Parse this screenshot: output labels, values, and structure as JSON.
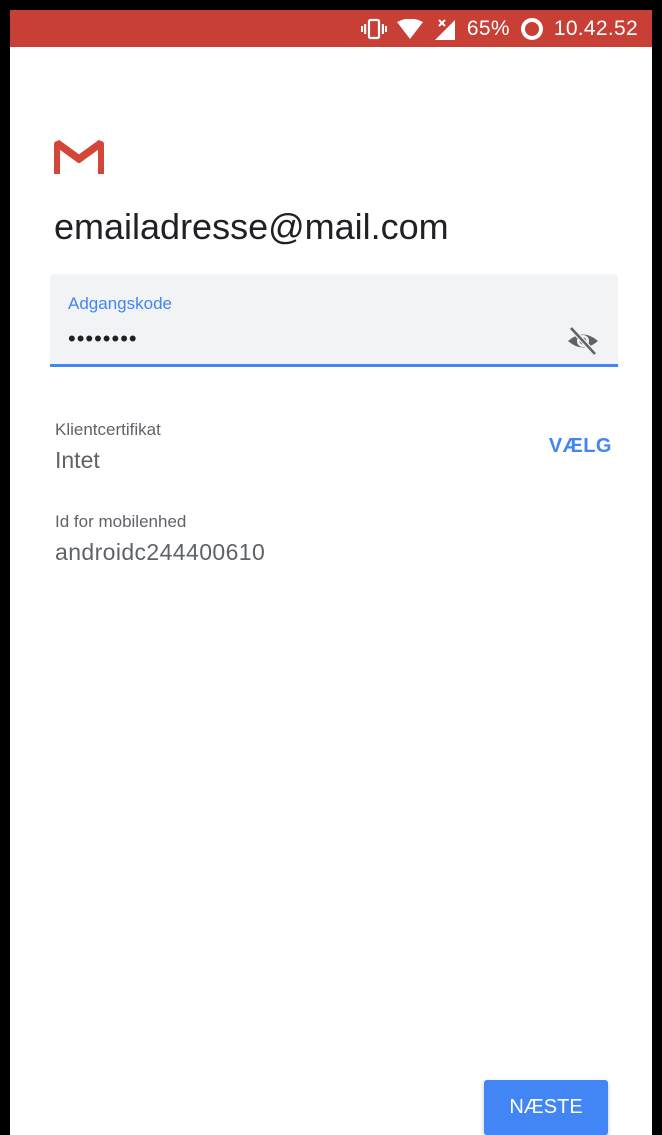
{
  "status_bar": {
    "battery": "65%",
    "time": "10.42.52",
    "icons": [
      "vibrate-icon",
      "wifi-icon",
      "cellular-no-signal-icon",
      "battery-icon"
    ],
    "background_color": "#c73f35"
  },
  "app": {
    "logo": "gmail-logo-icon",
    "brand_color": "#d44638"
  },
  "account": {
    "email": "emailadresse@mail.com"
  },
  "password": {
    "label": "Adgangskode",
    "value": "••••••••",
    "toggle_icon": "visibility-off-icon",
    "accent_color": "#4285f4"
  },
  "client_certificate": {
    "label": "Klientcertifikat",
    "value": "Intet",
    "action_label": "VÆLG"
  },
  "device_id": {
    "label": "Id for mobilenhed",
    "value": "androidc244400610"
  },
  "footer": {
    "next_label": "NÆSTE"
  }
}
